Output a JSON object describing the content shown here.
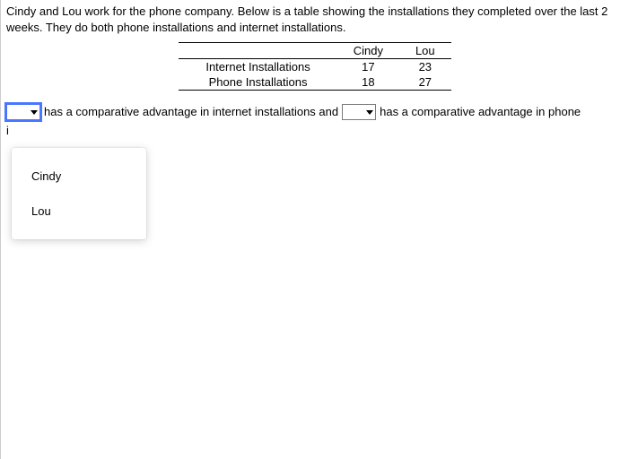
{
  "intro": "Cindy and Lou work for the phone company. Below is a table showing the installations they completed over the last 2 weeks.  They do both phone installations and internet installations.",
  "table": {
    "col_headers": [
      "Cindy",
      "Lou"
    ],
    "rows": [
      {
        "label": "Internet Installations",
        "cindy": "17",
        "lou": "23"
      },
      {
        "label": "Phone Installations",
        "cindy": "18",
        "lou": "27"
      }
    ]
  },
  "sentence": {
    "seg1": "has a comparative advantage in internet installations and",
    "seg2": "has a comparative advantage in phone"
  },
  "trailing": "i",
  "dropdown_options": [
    "Cindy",
    "Lou"
  ]
}
